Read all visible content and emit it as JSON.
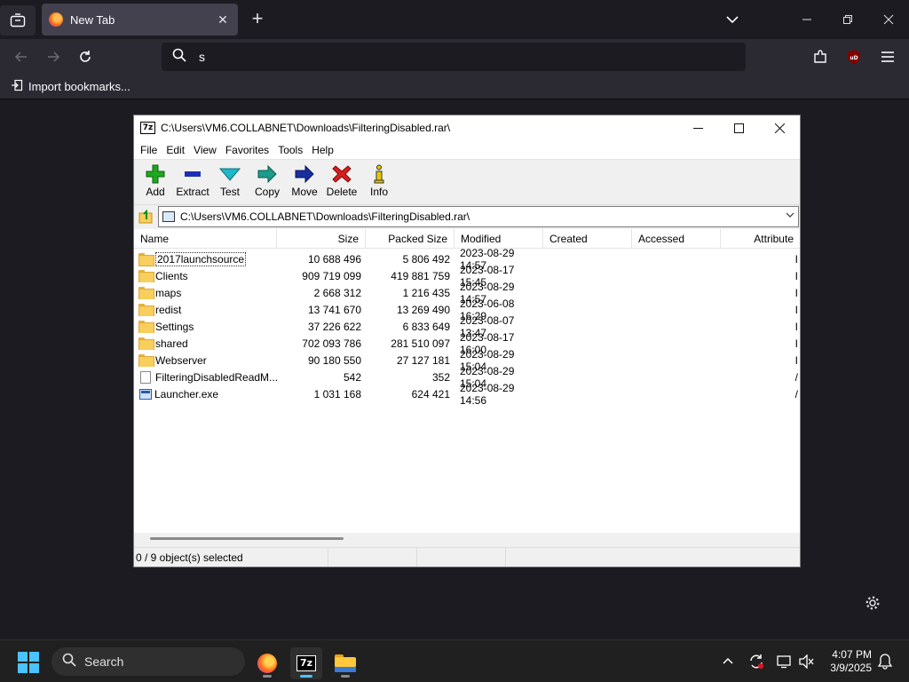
{
  "browser": {
    "tab_title": "New Tab",
    "address_text": "s",
    "bookmarks_label": "Import bookmarks..."
  },
  "icons": [
    "tab-list-icon",
    "firefox-icon",
    "close-icon",
    "plus-icon",
    "chevron-down-icon",
    "minimize-icon",
    "restore-icon",
    "back-icon",
    "forward-icon",
    "reload-icon",
    "search-icon",
    "extensions-icon",
    "ublock-icon",
    "menu-icon",
    "gear-icon"
  ],
  "sevenzip": {
    "app_icon_text": "7z",
    "window_title": "C:\\Users\\VM6.COLLABNET\\Downloads\\FilteringDisabled.rar\\",
    "menu": [
      "File",
      "Edit",
      "View",
      "Favorites",
      "Tools",
      "Help"
    ],
    "toolbar": [
      {
        "label": "Add",
        "icon": "add-icon",
        "color": "#1fa81f"
      },
      {
        "label": "Extract",
        "icon": "extract-icon",
        "color": "#1c2fb5"
      },
      {
        "label": "Test",
        "icon": "test-icon",
        "color": "#1eb7c9"
      },
      {
        "label": "Copy",
        "icon": "copy-icon",
        "color": "#1b9b8a"
      },
      {
        "label": "Move",
        "icon": "move-icon",
        "color": "#1a2f9e"
      },
      {
        "label": "Delete",
        "icon": "delete-icon",
        "color": "#d81e1e"
      },
      {
        "label": "Info",
        "icon": "info-icon",
        "color": "#e5c800"
      }
    ],
    "address_path": "C:\\Users\\VM6.COLLABNET\\Downloads\\FilteringDisabled.rar\\",
    "columns": [
      "Name",
      "Size",
      "Packed Size",
      "Modified",
      "Created",
      "Accessed",
      "Attribute"
    ],
    "files": [
      {
        "name": "2017launchsource",
        "size": "10 688 496",
        "packed": "5 806 492",
        "modified": "2023-08-29 14:57",
        "attr": "I",
        "type": "folder"
      },
      {
        "name": "Clients",
        "size": "909 719 099",
        "packed": "419 881 759",
        "modified": "2023-08-17 15:45",
        "attr": "I",
        "type": "folder"
      },
      {
        "name": "maps",
        "size": "2 668 312",
        "packed": "1 216 435",
        "modified": "2023-08-29 14:57",
        "attr": "I",
        "type": "folder"
      },
      {
        "name": "redist",
        "size": "13 741 670",
        "packed": "13 269 490",
        "modified": "2023-06-08 16:29",
        "attr": "I",
        "type": "folder"
      },
      {
        "name": "Settings",
        "size": "37 226 622",
        "packed": "6 833 649",
        "modified": "2023-08-07 13:47",
        "attr": "I",
        "type": "folder"
      },
      {
        "name": "shared",
        "size": "702 093 786",
        "packed": "281 510 097",
        "modified": "2023-08-17 16:00",
        "attr": "I",
        "type": "folder"
      },
      {
        "name": "Webserver",
        "size": "90 180 550",
        "packed": "27 127 181",
        "modified": "2023-08-29 15:04",
        "attr": "I",
        "type": "folder"
      },
      {
        "name": "FilteringDisabledReadM...",
        "size": "542",
        "packed": "352",
        "modified": "2023-08-29 15:04",
        "attr": "/",
        "type": "file"
      },
      {
        "name": "Launcher.exe",
        "size": "1 031 168",
        "packed": "624 421",
        "modified": "2023-08-29 14:56",
        "attr": "/",
        "type": "exe"
      }
    ],
    "status": "0 / 9 object(s) selected"
  },
  "taskbar": {
    "search_label": "Search",
    "time": "4:07 PM",
    "date": "3/9/2025",
    "accent": "#4cc2ff"
  }
}
